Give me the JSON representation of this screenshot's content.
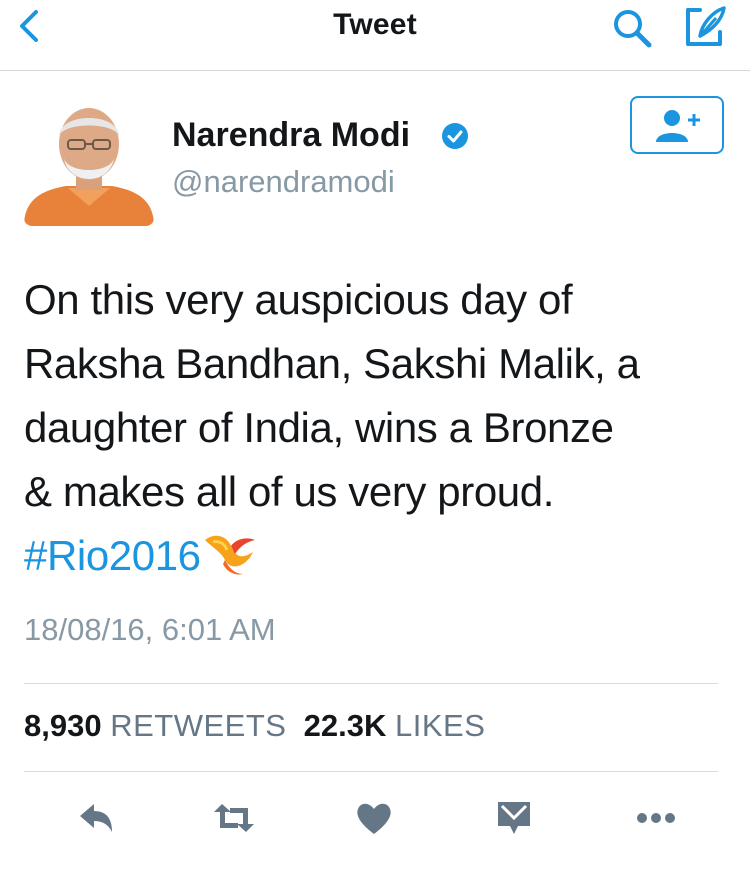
{
  "navbar": {
    "title": "Tweet",
    "back_icon": "chevron-left-icon",
    "search_icon": "search-icon",
    "compose_icon": "compose-icon"
  },
  "author": {
    "name": "Narendra Modi",
    "handle": "@narendramodi",
    "verified": true,
    "avatar_icon": "avatar"
  },
  "follow_button": {
    "icon": "add-user-icon"
  },
  "tweet": {
    "lines": [
      "On this very auspicious day of",
      "Raksha Bandhan, Sakshi Malik, a",
      "daughter of India, wins a Bronze",
      "& makes all of us very proud."
    ],
    "hashtag": "#Rio2016",
    "hashtag_emoji": "rio2016-emoji",
    "timestamp": "18/08/16, 6:01 AM"
  },
  "stats": {
    "retweets_count": "8,930",
    "retweets_label": "RETWEETS",
    "likes_count": "22.3K",
    "likes_label": "LIKES"
  },
  "actions": [
    "reply-icon",
    "retweet-icon",
    "like-icon",
    "direct-message-icon",
    "more-icon"
  ],
  "colors": {
    "accent": "#1b95e0",
    "action_gray": "#657786",
    "secondary_text": "#8899a6"
  }
}
